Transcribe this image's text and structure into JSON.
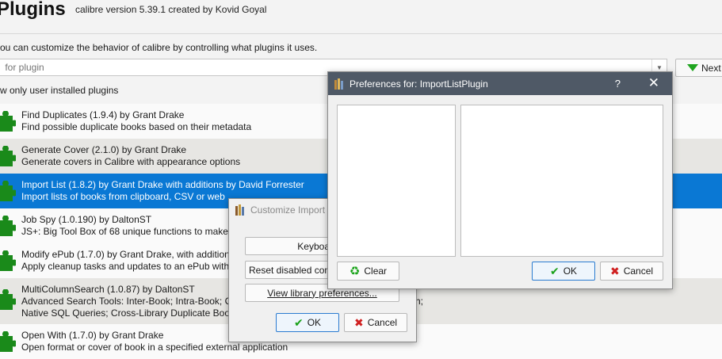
{
  "header": {
    "title": "Plugins",
    "subtitle": "calibre version 5.39.1 created by Kovid Goyal",
    "description": "ou can customize the behavior of calibre by controlling what plugins it uses."
  },
  "search": {
    "placeholder": " for plugin",
    "next_label": "Next"
  },
  "show_only": "w only user installed plugins",
  "plugins": [
    {
      "name": "Find Duplicates (1.9.4) by Grant Drake",
      "desc": "Find possible duplicate books based on their metadata"
    },
    {
      "name": "Generate Cover (2.1.0) by Grant Drake",
      "desc": "Generate covers in Calibre with appearance options"
    },
    {
      "name": "Import List (1.8.2) by Grant Drake with additions by David Forrester",
      "desc": "Import lists of books from clipboard, CSV or web"
    },
    {
      "name": "Job Spy (1.0.190) by DaltonST",
      "desc": "JS+: Big Tool Box of 68 unique functions to make"
    },
    {
      "name": "Modify ePub (1.7.0) by Grant Drake, with addition",
      "desc": "Apply cleanup tasks and updates to an ePub witho"
    },
    {
      "name": "MultiColumnSearch (1.0.87) by DaltonST",
      "desc": "Advanced Search Tools: Inter-Book; Intra-Book; Cr",
      "desc_tail": "ch;",
      "desc2": "Native SQL Queries; Cross-Library Duplicate Book"
    },
    {
      "name": "Open With (1.7.0) by Grant Drake",
      "desc": "Open format or cover of book in a specified external application"
    }
  ],
  "customize_dialog": {
    "title": "Customize Import",
    "keyboard_label": "Keyboard sh",
    "reset_label": "Reset disabled conf",
    "view_prefs_label": "View library preferences...",
    "ok_label": "OK",
    "cancel_label": "Cancel"
  },
  "pref_dialog": {
    "title": "Preferences for: ImportListPlugin",
    "help": "?",
    "close": "✕",
    "clear_label": "Clear",
    "ok_label": "OK",
    "cancel_label": "Cancel"
  },
  "colors": {
    "selection": "#0a78d4",
    "titlebar": "#4f5966",
    "plugin_green": "#1a8a1a"
  }
}
